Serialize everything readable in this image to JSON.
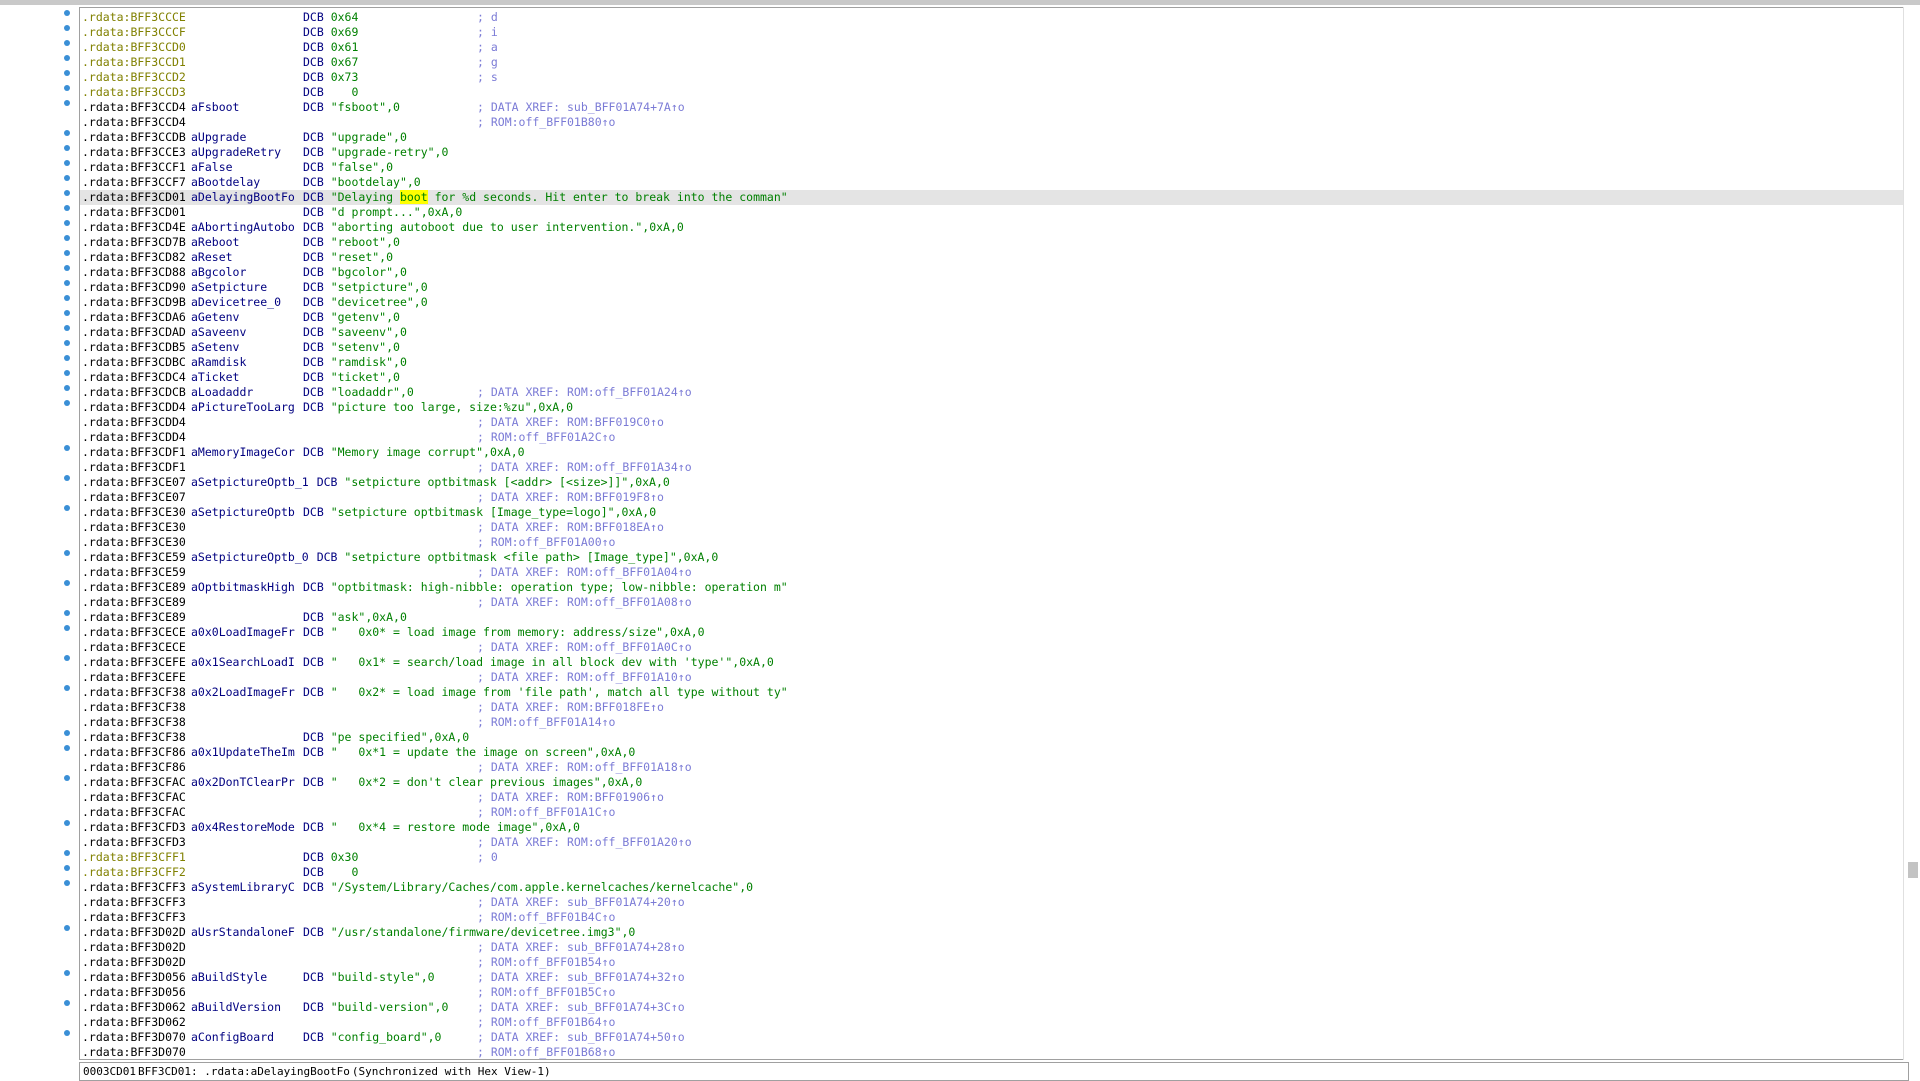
{
  "status_bar": {
    "offset": "0003CD01",
    "location": "BFF3CD01: .rdata:aDelayingBootFo",
    "sync": "(Synchronized with Hex View-1)"
  },
  "highlight_word": "boot",
  "lines": [
    {
      "a": ".rdata:BFF3CCCE",
      "n": "",
      "o": "DCB",
      "v": "0x64",
      "c": "; d",
      "y": true
    },
    {
      "a": ".rdata:BFF3CCCF",
      "n": "",
      "o": "DCB",
      "v": "0x69",
      "c": "; i",
      "y": true
    },
    {
      "a": ".rdata:BFF3CCD0",
      "n": "",
      "o": "DCB",
      "v": "0x61",
      "c": "; a",
      "y": true
    },
    {
      "a": ".rdata:BFF3CCD1",
      "n": "",
      "o": "DCB",
      "v": "0x67",
      "c": "; g",
      "y": true
    },
    {
      "a": ".rdata:BFF3CCD2",
      "n": "",
      "o": "DCB",
      "v": "0x73",
      "c": "; s",
      "y": true
    },
    {
      "a": ".rdata:BFF3CCD3",
      "n": "",
      "o": "DCB",
      "v": "   0",
      "c": "",
      "y": true
    },
    {
      "a": ".rdata:BFF3CCD4",
      "n": "aFsboot",
      "o": "DCB",
      "v": "\"fsboot\",0",
      "c": "; DATA XREF: sub_BFF01A74+7A↑o"
    },
    {
      "a": ".rdata:BFF3CCD4",
      "n": "",
      "o": "",
      "v": "",
      "c": "; ROM:off_BFF01B80↑o"
    },
    {
      "a": ".rdata:BFF3CCDB",
      "n": "aUpgrade",
      "o": "DCB",
      "v": "\"upgrade\",0",
      "c": ""
    },
    {
      "a": ".rdata:BFF3CCE3",
      "n": "aUpgradeRetry",
      "o": "DCB",
      "v": "\"upgrade-retry\",0",
      "c": ""
    },
    {
      "a": ".rdata:BFF3CCF1",
      "n": "aFalse",
      "o": "DCB",
      "v": "\"false\",0",
      "c": ""
    },
    {
      "a": ".rdata:BFF3CCF7",
      "n": "aBootdelay",
      "o": "DCB",
      "v": "\"bootdelay\",0",
      "c": ""
    },
    {
      "a": ".rdata:BFF3CD01",
      "n": "aDelayingBootFo",
      "o": "DCB",
      "v": "\"Delaying boot for %d seconds. Hit enter to break into the comman\"",
      "c": "",
      "hl": true
    },
    {
      "a": ".rdata:BFF3CD01",
      "n": "",
      "o": "DCB",
      "v": "\"d prompt...\",0xA,0",
      "c": ""
    },
    {
      "a": ".rdata:BFF3CD4E",
      "n": "aAbortingAutobo",
      "o": "DCB",
      "v": "\"aborting autoboot due to user intervention.\",0xA,0",
      "c": ""
    },
    {
      "a": ".rdata:BFF3CD7B",
      "n": "aReboot",
      "o": "DCB",
      "v": "\"reboot\",0",
      "c": ""
    },
    {
      "a": ".rdata:BFF3CD82",
      "n": "aReset",
      "o": "DCB",
      "v": "\"reset\",0",
      "c": ""
    },
    {
      "a": ".rdata:BFF3CD88",
      "n": "aBgcolor",
      "o": "DCB",
      "v": "\"bgcolor\",0",
      "c": ""
    },
    {
      "a": ".rdata:BFF3CD90",
      "n": "aSetpicture",
      "o": "DCB",
      "v": "\"setpicture\",0",
      "c": ""
    },
    {
      "a": ".rdata:BFF3CD9B",
      "n": "aDevicetree_0",
      "o": "DCB",
      "v": "\"devicetree\",0",
      "c": ""
    },
    {
      "a": ".rdata:BFF3CDA6",
      "n": "aGetenv",
      "o": "DCB",
      "v": "\"getenv\",0",
      "c": ""
    },
    {
      "a": ".rdata:BFF3CDAD",
      "n": "aSaveenv",
      "o": "DCB",
      "v": "\"saveenv\",0",
      "c": ""
    },
    {
      "a": ".rdata:BFF3CDB5",
      "n": "aSetenv",
      "o": "DCB",
      "v": "\"setenv\",0",
      "c": ""
    },
    {
      "a": ".rdata:BFF3CDBC",
      "n": "aRamdisk",
      "o": "DCB",
      "v": "\"ramdisk\",0",
      "c": ""
    },
    {
      "a": ".rdata:BFF3CDC4",
      "n": "aTicket",
      "o": "DCB",
      "v": "\"ticket\",0",
      "c": ""
    },
    {
      "a": ".rdata:BFF3CDCB",
      "n": "aLoadaddr",
      "o": "DCB",
      "v": "\"loadaddr\",0",
      "c": "; DATA XREF: ROM:off_BFF01A24↑o"
    },
    {
      "a": ".rdata:BFF3CDD4",
      "n": "aPictureTooLarg",
      "o": "DCB",
      "v": "\"picture too large, size:%zu\",0xA,0",
      "c": ""
    },
    {
      "a": ".rdata:BFF3CDD4",
      "n": "",
      "o": "",
      "v": "",
      "c": "; DATA XREF: ROM:BFF019C0↑o"
    },
    {
      "a": ".rdata:BFF3CDD4",
      "n": "",
      "o": "",
      "v": "",
      "c": "; ROM:off_BFF01A2C↑o"
    },
    {
      "a": ".rdata:BFF3CDF1",
      "n": "aMemoryImageCor",
      "o": "DCB",
      "v": "\"Memory image corrupt\",0xA,0",
      "c": ""
    },
    {
      "a": ".rdata:BFF3CDF1",
      "n": "",
      "o": "",
      "v": "",
      "c": "; DATA XREF: ROM:off_BFF01A34↑o"
    },
    {
      "a": ".rdata:BFF3CE07",
      "n": "aSetpictureOptb_1",
      "o": "DCB",
      "v": "\"setpicture optbitmask [<addr> [<size>]]\",0xA,0",
      "c": "",
      "wide": true
    },
    {
      "a": ".rdata:BFF3CE07",
      "n": "",
      "o": "",
      "v": "",
      "c": "; DATA XREF: ROM:BFF019F8↑o"
    },
    {
      "a": ".rdata:BFF3CE30",
      "n": "aSetpictureOptb",
      "o": "DCB",
      "v": "\"setpicture optbitmask [Image_type=logo]\",0xA,0",
      "c": ""
    },
    {
      "a": ".rdata:BFF3CE30",
      "n": "",
      "o": "",
      "v": "",
      "c": "; DATA XREF: ROM:BFF018EA↑o"
    },
    {
      "a": ".rdata:BFF3CE30",
      "n": "",
      "o": "",
      "v": "",
      "c": "; ROM:off_BFF01A00↑o"
    },
    {
      "a": ".rdata:BFF3CE59",
      "n": "aSetpictureOptb_0",
      "o": "DCB",
      "v": "\"setpicture optbitmask <file path> [Image_type]\",0xA,0",
      "c": "",
      "wide": true
    },
    {
      "a": ".rdata:BFF3CE59",
      "n": "",
      "o": "",
      "v": "",
      "c": "; DATA XREF: ROM:off_BFF01A04↑o"
    },
    {
      "a": ".rdata:BFF3CE89",
      "n": "aOptbitmaskHigh",
      "o": "DCB",
      "v": "\"optbitmask: high-nibble: operation type; low-nibble: operation m\"",
      "c": ""
    },
    {
      "a": ".rdata:BFF3CE89",
      "n": "",
      "o": "",
      "v": "",
      "c": "; DATA XREF: ROM:off_BFF01A08↑o"
    },
    {
      "a": ".rdata:BFF3CE89",
      "n": "",
      "o": "DCB",
      "v": "\"ask\",0xA,0",
      "c": ""
    },
    {
      "a": ".rdata:BFF3CECE",
      "n": "a0x0LoadImageFr",
      "o": "DCB",
      "v": "\"   0x0* = load image from memory: address/size\",0xA,0",
      "c": ""
    },
    {
      "a": ".rdata:BFF3CECE",
      "n": "",
      "o": "",
      "v": "",
      "c": "; DATA XREF: ROM:off_BFF01A0C↑o"
    },
    {
      "a": ".rdata:BFF3CEFE",
      "n": "a0x1SearchLoadI",
      "o": "DCB",
      "v": "\"   0x1* = search/load image in all block dev with 'type'\",0xA,0",
      "c": ""
    },
    {
      "a": ".rdata:BFF3CEFE",
      "n": "",
      "o": "",
      "v": "",
      "c": "; DATA XREF: ROM:off_BFF01A10↑o"
    },
    {
      "a": ".rdata:BFF3CF38",
      "n": "a0x2LoadImageFr",
      "o": "DCB",
      "v": "\"   0x2* = load image from 'file path', match all type without ty\"",
      "c": ""
    },
    {
      "a": ".rdata:BFF3CF38",
      "n": "",
      "o": "",
      "v": "",
      "c": "; DATA XREF: ROM:BFF018FE↑o"
    },
    {
      "a": ".rdata:BFF3CF38",
      "n": "",
      "o": "",
      "v": "",
      "c": "; ROM:off_BFF01A14↑o"
    },
    {
      "a": ".rdata:BFF3CF38",
      "n": "",
      "o": "DCB",
      "v": "\"pe specified\",0xA,0",
      "c": ""
    },
    {
      "a": ".rdata:BFF3CF86",
      "n": "a0x1UpdateTheIm",
      "o": "DCB",
      "v": "\"   0x*1 = update the image on screen\",0xA,0",
      "c": ""
    },
    {
      "a": ".rdata:BFF3CF86",
      "n": "",
      "o": "",
      "v": "",
      "c": "; DATA XREF: ROM:off_BFF01A18↑o"
    },
    {
      "a": ".rdata:BFF3CFAC",
      "n": "a0x2DonTClearPr",
      "o": "DCB",
      "v": "\"   0x*2 = don't clear previous images\",0xA,0",
      "c": ""
    },
    {
      "a": ".rdata:BFF3CFAC",
      "n": "",
      "o": "",
      "v": "",
      "c": "; DATA XREF: ROM:BFF01906↑o"
    },
    {
      "a": ".rdata:BFF3CFAC",
      "n": "",
      "o": "",
      "v": "",
      "c": "; ROM:off_BFF01A1C↑o"
    },
    {
      "a": ".rdata:BFF3CFD3",
      "n": "a0x4RestoreMode",
      "o": "DCB",
      "v": "\"   0x*4 = restore mode image\",0xA,0",
      "c": ""
    },
    {
      "a": ".rdata:BFF3CFD3",
      "n": "",
      "o": "",
      "v": "",
      "c": "; DATA XREF: ROM:off_BFF01A20↑o"
    },
    {
      "a": ".rdata:BFF3CFF1",
      "n": "",
      "o": "DCB",
      "v": "0x30",
      "c": "; 0",
      "y": true
    },
    {
      "a": ".rdata:BFF3CFF2",
      "n": "",
      "o": "DCB",
      "v": "   0",
      "c": "",
      "y": true
    },
    {
      "a": ".rdata:BFF3CFF3",
      "n": "aSystemLibraryC",
      "o": "DCB",
      "v": "\"/System/Library/Caches/com.apple.kernelcaches/kernelcache\",0",
      "c": ""
    },
    {
      "a": ".rdata:BFF3CFF3",
      "n": "",
      "o": "",
      "v": "",
      "c": "; DATA XREF: sub_BFF01A74+20↑o"
    },
    {
      "a": ".rdata:BFF3CFF3",
      "n": "",
      "o": "",
      "v": "",
      "c": "; ROM:off_BFF01B4C↑o"
    },
    {
      "a": ".rdata:BFF3D02D",
      "n": "aUsrStandaloneF",
      "o": "DCB",
      "v": "\"/usr/standalone/firmware/devicetree.img3\",0",
      "c": ""
    },
    {
      "a": ".rdata:BFF3D02D",
      "n": "",
      "o": "",
      "v": "",
      "c": "; DATA XREF: sub_BFF01A74+28↑o"
    },
    {
      "a": ".rdata:BFF3D02D",
      "n": "",
      "o": "",
      "v": "",
      "c": "; ROM:off_BFF01B54↑o"
    },
    {
      "a": ".rdata:BFF3D056",
      "n": "aBuildStyle",
      "o": "DCB",
      "v": "\"build-style\",0",
      "c": "; DATA XREF: sub_BFF01A74+32↑o"
    },
    {
      "a": ".rdata:BFF3D056",
      "n": "",
      "o": "",
      "v": "",
      "c": "; ROM:off_BFF01B5C↑o"
    },
    {
      "a": ".rdata:BFF3D062",
      "n": "aBuildVersion",
      "o": "DCB",
      "v": "\"build-version\",0",
      "c": "; DATA XREF: sub_BFF01A74+3C↑o"
    },
    {
      "a": ".rdata:BFF3D062",
      "n": "",
      "o": "",
      "v": "",
      "c": "; ROM:off_BFF01B64↑o"
    },
    {
      "a": ".rdata:BFF3D070",
      "n": "aConfigBoard",
      "o": "DCB",
      "v": "\"config_board\",0",
      "c": "; DATA XREF: sub_BFF01A74+50↑o"
    },
    {
      "a": ".rdata:BFF3D070",
      "n": "",
      "o": "",
      "v": "",
      "c": "; ROM:off_BFF01B68↑o"
    }
  ]
}
